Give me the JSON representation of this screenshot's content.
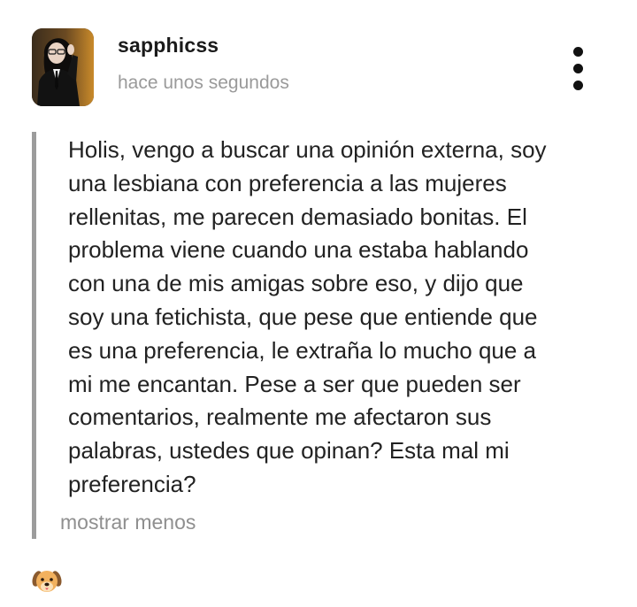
{
  "post": {
    "username": "sapphicss",
    "timestamp": "hace unos segundos",
    "more_icon": "vertical-ellipsis-icon",
    "body_lines": [
      "Holis, vengo a buscar una opinión externa, soy",
      "una lesbiana con preferencia a las mujeres",
      "rellenitas, me parecen demasiado bonitas. El",
      "problema viene cuando una estaba hablando",
      "con una de mis amigas sobre eso, y dijo que",
      "soy una fetichista, que pese que entiende que",
      "es una preferencia, le extraña lo mucho que a",
      "mi me encantan. Pese a ser que pueden ser",
      "comentarios, realmente me afectaron sus",
      "palabras, ustedes que opinan? Esta mal mi",
      "preferencia?"
    ],
    "show_less_label": "mostrar menos",
    "reaction_icon": "dog-face-emoji",
    "colors": {
      "username": "#1a1a1a",
      "timestamp": "#9a9a9a",
      "body_text": "#222222",
      "quote_bar": "#9c9c9c",
      "show_less": "#8f8f8f"
    }
  }
}
